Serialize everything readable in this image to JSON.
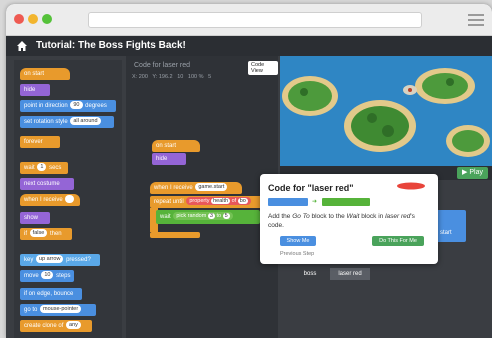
{
  "header": {
    "title": "Tutorial: The Boss Fights Back!"
  },
  "palette": {
    "blocks": [
      {
        "label": "on start",
        "color": "orange",
        "hat": true
      },
      {
        "label": "hide",
        "color": "purple"
      },
      {
        "label": "point in direction",
        "value": "90",
        "suffix": "degrees",
        "color": "blue"
      },
      {
        "label": "set rotation style",
        "value": "all around",
        "color": "blue"
      },
      {
        "label": "forever",
        "color": "orange"
      },
      {
        "label": "wait",
        "value": "1",
        "suffix": "secs",
        "color": "orange"
      },
      {
        "label": "next costume",
        "color": "purple"
      },
      {
        "label": "when I receive",
        "color": "orange",
        "hat": true
      },
      {
        "label": "show",
        "color": "purple"
      },
      {
        "label": "if",
        "value": "false",
        "suffix": "then",
        "color": "orange"
      },
      {
        "label": "key",
        "value": "up arrow",
        "suffix": "pressed?",
        "color": "lightblue"
      },
      {
        "label": "move",
        "value": "10",
        "suffix": "steps",
        "color": "blue"
      },
      {
        "label": "if on edge, bounce",
        "color": "blue"
      },
      {
        "label": "go to",
        "value": "mouse-pointer",
        "color": "blue"
      },
      {
        "label": "create clone of",
        "value": "any",
        "color": "orange"
      }
    ]
  },
  "workspace": {
    "title": "Code for laser red",
    "view_button": "Code View",
    "coords": [
      "X: 200",
      "Y: 196.2",
      "10",
      "100 %",
      "5"
    ],
    "script1": {
      "hat": "on start",
      "block": "hide"
    },
    "script2": {
      "hat": "when I receive",
      "hat_value": "game.start",
      "repeat": "repeat until",
      "property": "property",
      "property_value": "health",
      "of_label": "of",
      "of_value": "bo",
      "wait": "wait",
      "random": "pick random",
      "rand_a": "3",
      "rand_to": "to",
      "rand_b": "5"
    }
  },
  "stage": {
    "play_label": "Play"
  },
  "sprites": {
    "items": [
      "boss",
      "laser red"
    ],
    "start_label": "start"
  },
  "tooltip": {
    "title": "Code for \"laser red\"",
    "body_parts": [
      "Add the ",
      "Go To",
      " block to the ",
      "Wait",
      " block in ",
      "laser red",
      "'s code."
    ],
    "show_me": "Show Me",
    "do_this": "Do This For Me",
    "previous": "Previous Step"
  }
}
